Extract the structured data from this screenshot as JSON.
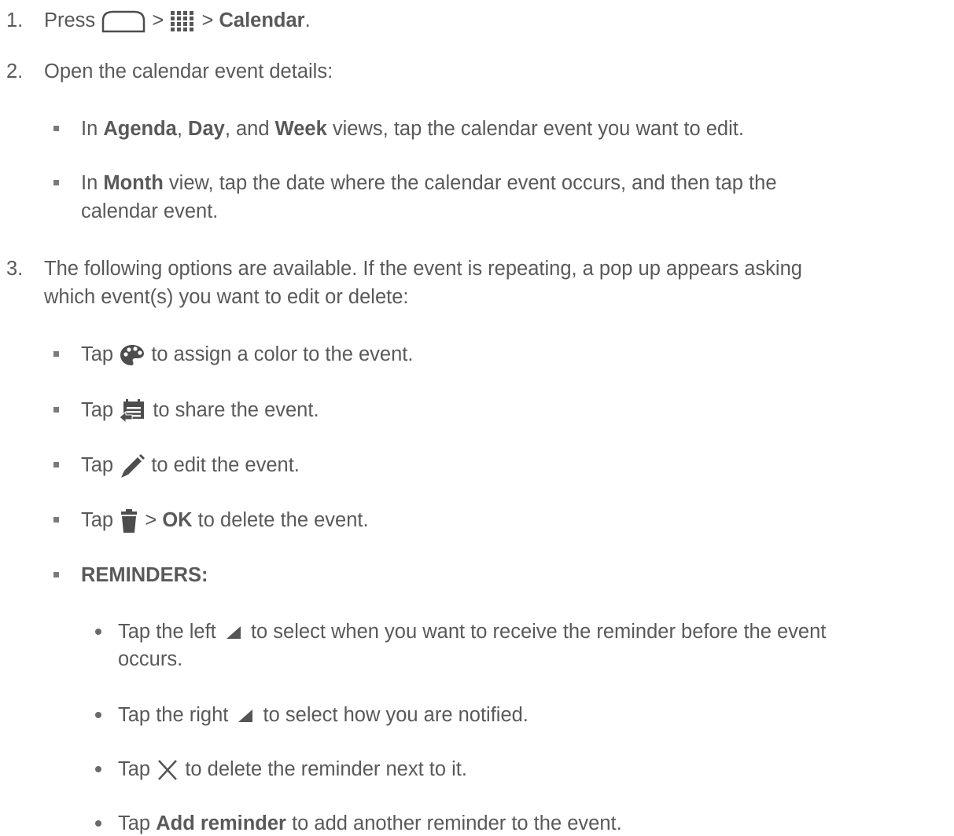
{
  "steps": [
    {
      "number": "1.",
      "press": "Press",
      "gt1": ">",
      "gt2": ">",
      "calendar": "Calendar",
      "end": "."
    },
    {
      "number": "2.",
      "text": "Open the calendar event details:"
    },
    {
      "number": "3.",
      "line1": "The following options are available. If the event is repeating, a pop up appears asking",
      "line2": "which event(s) you want to edit or delete:"
    }
  ],
  "step2_bullets": {
    "b1": {
      "pre": "In ",
      "agenda": "Agenda",
      "c1": ", ",
      "day": "Day",
      "c2": ", and ",
      "week": "Week",
      "post": " views, tap the calendar event you want to edit."
    },
    "b2": {
      "pre": "In ",
      "month": "Month",
      "post": " view, tap the date where the calendar event occurs, and then tap the",
      "line2": "calendar event."
    }
  },
  "step3_bullets": {
    "color": {
      "tap": "Tap",
      "post": "to assign a color to the event."
    },
    "share": {
      "tap": "Tap",
      "post": "to share the event."
    },
    "edit": {
      "tap": "Tap",
      "post": "to edit the event."
    },
    "delete": {
      "tap": "Tap",
      "gt": ">",
      "ok": "OK",
      "post": "to delete the event."
    },
    "reminders": "REMINDERS:"
  },
  "reminder_items": {
    "left": {
      "pre": "Tap the left",
      "post": "to select when you want to receive the reminder before the event",
      "line2": "occurs."
    },
    "right": {
      "pre": "Tap the right",
      "post": "to select how you are notified."
    },
    "remove": {
      "tap": "Tap",
      "post": "to delete the reminder next to it."
    },
    "add": {
      "tap": "Tap ",
      "label": "Add reminder",
      "post": " to add another reminder to the event."
    }
  },
  "icons": {
    "home": "home-icon",
    "apps": "apps-icon",
    "palette": "palette-icon",
    "share": "share-icon",
    "edit": "pencil-icon",
    "trash": "trash-icon",
    "dropdown": "dropdown-triangle-icon",
    "close": "close-icon"
  },
  "colors": {
    "text": "#595959",
    "icon": "#4d4d4d",
    "bullet": "#7a7a7a"
  }
}
